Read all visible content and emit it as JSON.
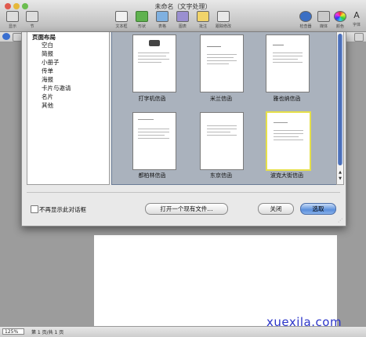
{
  "window": {
    "title": "未命名（文字处理）"
  },
  "toolbar": {
    "left": [
      {
        "label": "显示",
        "icon": "view-icon"
      },
      {
        "label": "节",
        "icon": "sections-icon"
      }
    ],
    "center": [
      {
        "label": "文本框",
        "icon": "textbox-icon"
      },
      {
        "label": "形状",
        "icon": "shapes-icon"
      },
      {
        "label": "表格",
        "icon": "table-icon"
      },
      {
        "label": "图表",
        "icon": "chart-icon"
      },
      {
        "label": "批注",
        "icon": "comment-icon"
      },
      {
        "label": "跟踪修改",
        "icon": "track-changes-icon"
      }
    ],
    "right": [
      {
        "label": "检查器",
        "icon": "inspector-icon"
      },
      {
        "label": "媒体",
        "icon": "media-icon"
      },
      {
        "label": "颜色",
        "icon": "colors-icon"
      },
      {
        "label": "字体",
        "icon": "fonts-icon"
      }
    ]
  },
  "sheet": {
    "category_header": "页面布局",
    "categories": [
      "空白",
      "简报",
      "小册子",
      "传单",
      "海报",
      "卡片与邀请",
      "名片",
      "其他"
    ],
    "templates": [
      {
        "label": "打字机信函"
      },
      {
        "label": "米兰信函"
      },
      {
        "label": "雅也纳信函"
      },
      {
        "label": "都柏林信函"
      },
      {
        "label": "东京信函"
      },
      {
        "label": "波克大街信函",
        "selected": true
      }
    ],
    "checkbox_label": "不再显示此对话框",
    "open_existing_label": "打开一个现有文件...",
    "close_label": "关闭",
    "choose_label": "选取"
  },
  "statusbar": {
    "zoom": "125%",
    "page_info": "第 1 页/共 1 页"
  },
  "watermark": "xuexila.com",
  "colors": {
    "accent": "#5b8fdc",
    "selection": "#e6e04a",
    "gallery_bg": "#aab2bd"
  }
}
